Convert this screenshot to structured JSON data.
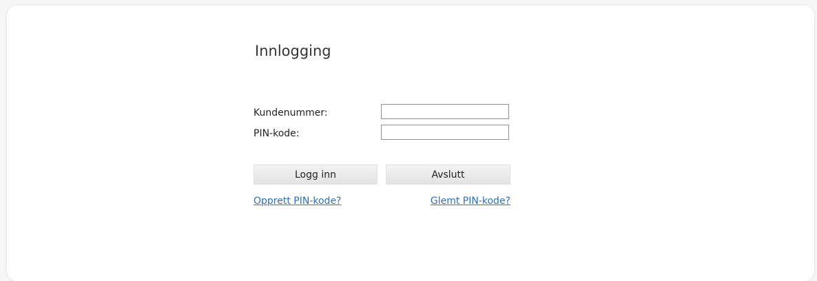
{
  "login": {
    "title": "Innlogging",
    "customer_number_label": "Kundenummer:",
    "customer_number_value": "",
    "pin_label": "PIN-kode:",
    "pin_value": "",
    "login_button": "Logg inn",
    "exit_button": "Avslutt",
    "create_pin_link": "Opprett PIN-kode?",
    "forgot_pin_link": "Glemt PIN-kode?"
  },
  "colors": {
    "link": "#2b6fb6",
    "panel_background": "#ffffff",
    "page_background": "#f6f6f6"
  }
}
